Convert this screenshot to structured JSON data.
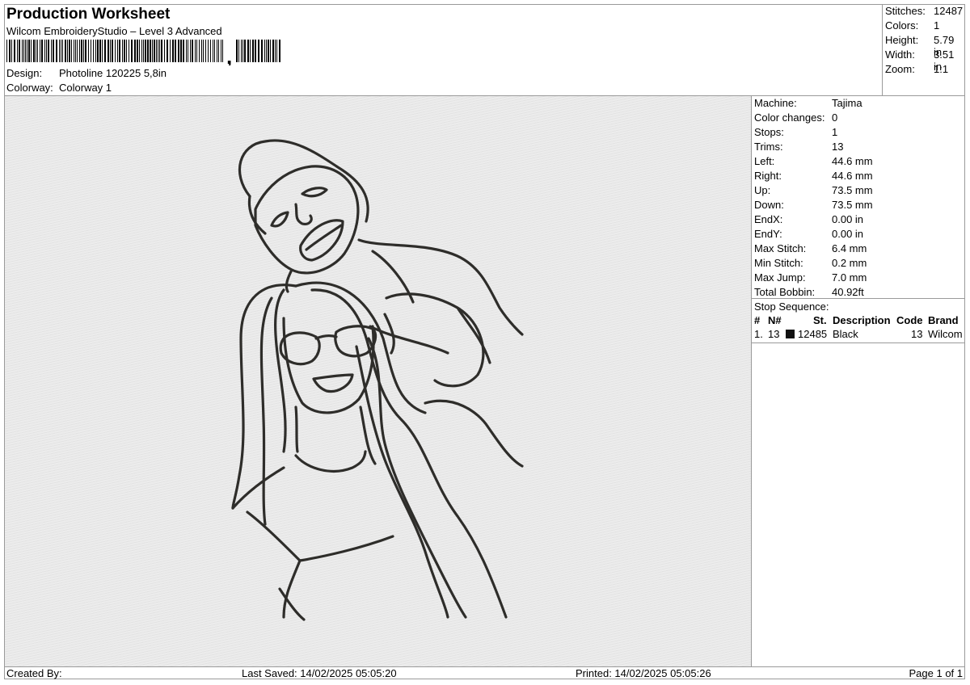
{
  "header": {
    "title": "Production Worksheet",
    "subtitle": "Wilcom EmbroideryStudio – Level 3 Advanced",
    "barcode_icon": "barcode-icon",
    "design_label": "Design:",
    "design_value": "Photoline 120225 5,8in",
    "colorway_label": "Colorway:",
    "colorway_value": "Colorway 1"
  },
  "summary": [
    {
      "label": "Stitches:",
      "value": "12487"
    },
    {
      "label": "Colors:",
      "value": "1"
    },
    {
      "label": "Height:",
      "value": "5.79 in"
    },
    {
      "label": "Width:",
      "value": "3.51 in"
    },
    {
      "label": "Zoom:",
      "value": "1:1"
    }
  ],
  "details": [
    {
      "label": "Machine:",
      "value": "Tajima"
    },
    {
      "label": "Color changes:",
      "value": "0"
    },
    {
      "label": "Stops:",
      "value": "1"
    },
    {
      "label": "Trims:",
      "value": "13"
    },
    {
      "label": "Left:",
      "value": "44.6 mm"
    },
    {
      "label": "Right:",
      "value": "44.6 mm"
    },
    {
      "label": "Up:",
      "value": "73.5 mm"
    },
    {
      "label": "Down:",
      "value": "73.5 mm"
    },
    {
      "label": "EndX:",
      "value": "0.00 in"
    },
    {
      "label": "EndY:",
      "value": "0.00 in"
    },
    {
      "label": "Max Stitch:",
      "value": "6.4 mm"
    },
    {
      "label": "Min Stitch:",
      "value": "0.2 mm"
    },
    {
      "label": "Max Jump:",
      "value": "7.0 mm"
    },
    {
      "label": "Total Bobbin:",
      "value": "40.92ft"
    }
  ],
  "stop_sequence": {
    "label": "Stop Sequence:",
    "headers": {
      "num": "#",
      "n": "N#",
      "st": "St.",
      "description": "Description",
      "code": "Code",
      "brand": "Brand"
    },
    "rows": [
      {
        "num": "1.",
        "n": "13",
        "color": "#111111",
        "st": "12485",
        "description": "Black",
        "code": "13",
        "brand": "Wilcom"
      }
    ]
  },
  "footer": {
    "created_by": "Created By:",
    "last_saved": "Last Saved: 14/02/2025 05:05:20",
    "printed": "Printed: 14/02/2025 05:05:26",
    "page": "Page 1 of 1"
  },
  "design_preview": {
    "thread_color": "#2e2d2a",
    "background_color": "#e8e8e8",
    "icon": "line-art-portrait"
  }
}
